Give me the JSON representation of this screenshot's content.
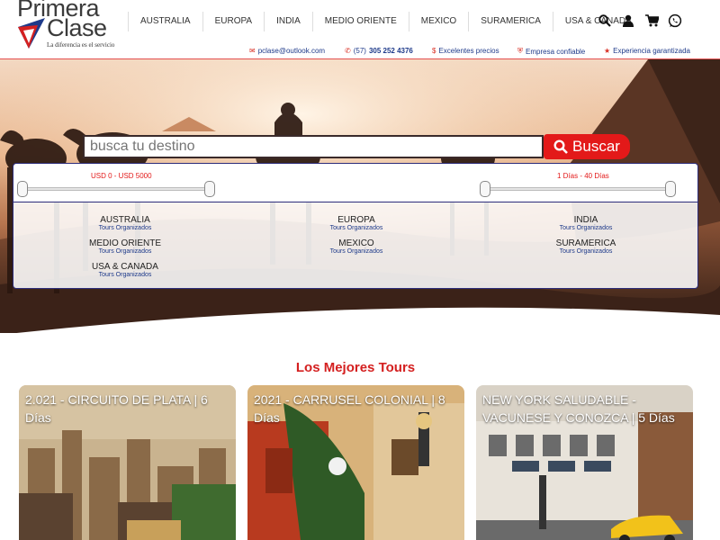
{
  "brand": {
    "name_line1": "Primera",
    "name_line2": "Clase",
    "tagline": "La diferencia es el servicio"
  },
  "nav": {
    "items": [
      "AUSTRALIA",
      "EUROPA",
      "INDIA",
      "MEDIO ORIENTE",
      "MEXICO",
      "SURAMERICA",
      "USA & CANADA"
    ],
    "icons": [
      "search-icon",
      "user-icon",
      "cart-icon",
      "whatsapp-icon"
    ]
  },
  "infobar": {
    "email": "pclase@outlook.com",
    "phone_prefix": "(57)",
    "phone_number": "305 252 4376",
    "price": "Excelentes precios",
    "trust": "Empresa confiable",
    "experience": "Experiencia garantizada"
  },
  "search": {
    "placeholder": "busca tu destino",
    "button_label": "Buscar"
  },
  "filters": {
    "price_range": "USD 0 - USD 5000",
    "days_range": "1 Días - 40 Días",
    "price_min_fraction": 0.0,
    "price_max_fraction": 1.0,
    "days_min_fraction": 0.0,
    "days_max_fraction": 1.0
  },
  "regions": [
    {
      "name": "AUSTRALIA",
      "sub": "Tours Organizados"
    },
    {
      "name": "EUROPA",
      "sub": "Tours Organizados"
    },
    {
      "name": "INDIA",
      "sub": "Tours Organizados"
    },
    {
      "name": "MEDIO ORIENTE",
      "sub": "Tours Organizados"
    },
    {
      "name": "MEXICO",
      "sub": "Tours Organizados"
    },
    {
      "name": "SURAMERICA",
      "sub": "Tours Organizados"
    },
    {
      "name": "USA & CANADA",
      "sub": "Tours Organizados"
    }
  ],
  "tours": {
    "section_title": "Los Mejores Tours",
    "cards": [
      {
        "title": "2.021 - CIRCUITO DE PLATA | 6 Días"
      },
      {
        "title": "2021 - CARRUSEL COLONIAL | 8 Días"
      },
      {
        "title": "NEW YORK SALUDABLE - VACUNESE Y CONOZCA | 5 Días"
      }
    ]
  },
  "colors": {
    "accent_red": "#e31919",
    "link_blue": "#1e3a8a",
    "panel_border": "#2c2c7a"
  }
}
